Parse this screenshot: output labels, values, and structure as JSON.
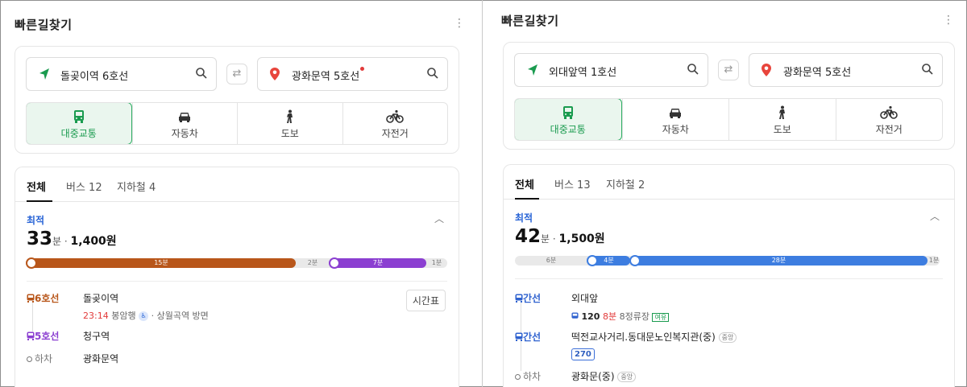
{
  "colors": {
    "green_accent": "#2dae63",
    "line6": "#b8561a",
    "line5": "#8b3fd1",
    "line1": "#3d7de0",
    "bus_blue": "#2f62cf",
    "optimal_blue": "#2763d6"
  },
  "left": {
    "title": "빠른길찾기",
    "origin": "돌곶이역 6호선",
    "destination": "광화문역 5호선",
    "swap_icon": "⇄",
    "modes": [
      {
        "icon": "bus-icon",
        "label": "대중교통"
      },
      {
        "icon": "car-icon",
        "label": "자동차"
      },
      {
        "icon": "walk-icon",
        "label": "도보"
      },
      {
        "icon": "bike-icon",
        "label": "자전거"
      }
    ],
    "tabs": [
      "전체",
      "버스 12",
      "지하철 4"
    ],
    "optimal_label": "최적",
    "time_value": "33",
    "time_unit": "분",
    "fare": "1,400원",
    "segments": [
      {
        "label": "15분",
        "color": "#b8561a",
        "fraction": 0.64
      },
      {
        "label": "2분",
        "color": "gap",
        "fraction": 0.08
      },
      {
        "label": "7분",
        "color": "#8b3fd1",
        "fraction": 0.23
      },
      {
        "label": "1분",
        "color": "gap",
        "fraction": 0.05
      }
    ],
    "steps": [
      {
        "line": "6호선",
        "station": "돌곶이역",
        "time": "23:14",
        "direction": "봉암행",
        "towards": "상월곡역 방면"
      },
      {
        "line": "5호선",
        "station": "청구역"
      },
      {
        "line": "하차",
        "station": "광화문역"
      }
    ],
    "timetable_button": "시간표"
  },
  "right": {
    "title": "빠른길찾기",
    "origin": "외대앞역 1호선",
    "destination": "광화문역 5호선",
    "swap_icon": "⇄",
    "modes": [
      {
        "icon": "bus-icon",
        "label": "대중교통"
      },
      {
        "icon": "car-icon",
        "label": "자동차"
      },
      {
        "icon": "walk-icon",
        "label": "도보"
      },
      {
        "icon": "bike-icon",
        "label": "자전거"
      }
    ],
    "tabs": [
      "전체",
      "버스 13",
      "지하철 2"
    ],
    "optimal_label": "최적",
    "time_value": "42",
    "time_unit": "분",
    "fare": "1,500원",
    "segments": [
      {
        "label": "6분",
        "color": "gap",
        "fraction": 0.17
      },
      {
        "label": "4분",
        "color": "#3d7de0",
        "fraction": 0.1
      },
      {
        "label": "28분",
        "color": "#3d7de0",
        "fraction": 0.7
      },
      {
        "label": "1분",
        "color": "gap",
        "fraction": 0.03
      }
    ],
    "steps": [
      {
        "line": "간선",
        "station": "외대앞",
        "bus_no": "120",
        "wait": "8분",
        "stops": "8정류장",
        "tag": "여유"
      },
      {
        "line": "간선",
        "station": "떡전교사거리.동대문노인복지관(중)",
        "chip": "중앙",
        "bus_no": "270"
      },
      {
        "line": "하차",
        "station": "광화문(중)",
        "chip": "중앙"
      }
    ]
  }
}
